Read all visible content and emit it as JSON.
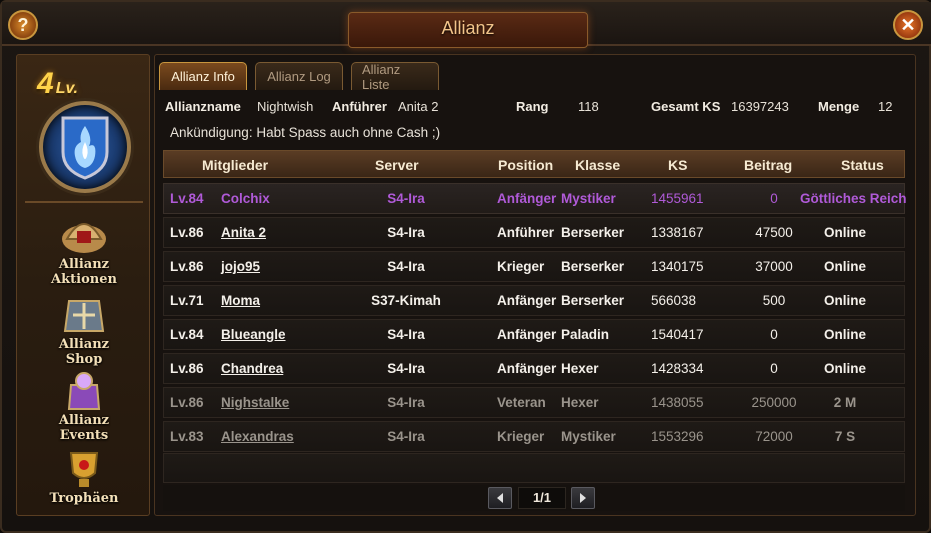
{
  "window": {
    "title": "Allianz",
    "help_label": "?",
    "close_label": "✕"
  },
  "sidebar": {
    "level_number": "4",
    "level_suffix": "Lv.",
    "items": [
      {
        "label_line1": "Allianz",
        "label_line2": "Aktionen",
        "icon": "helmet-icon"
      },
      {
        "label_line1": "Allianz",
        "label_line2": "Shop",
        "icon": "shop-icon"
      },
      {
        "label_line1": "Allianz",
        "label_line2": "Events",
        "icon": "events-icon"
      },
      {
        "label_line1": "Trophäen",
        "label_line2": "",
        "icon": "trophy-icon"
      }
    ]
  },
  "tabs": [
    {
      "label": "Allianz Info",
      "active": true
    },
    {
      "label": "Allianz Log",
      "active": false
    },
    {
      "label": "Allianz Liste",
      "active": false
    }
  ],
  "info": {
    "name_label": "Allianzname",
    "name_value": "Nightwish",
    "leader_label": "Anführer",
    "leader_value": "Anita 2",
    "rank_label": "Rang",
    "rank_value": "118",
    "total_label": "Gesamt KS",
    "total_value": "16397243",
    "count_label": "Menge",
    "count_value": "12",
    "announcement": "Ankündigung: Habt Spass auch ohne Cash ;)"
  },
  "table": {
    "headers": [
      "Mitglieder",
      "Server",
      "Position",
      "Klasse",
      "KS",
      "Beitrag",
      "Status"
    ],
    "rows": [
      {
        "level": "Lv.84",
        "name": "Colchix",
        "server": "S4-Ira",
        "position": "Anfänger",
        "klasse": "Mystiker",
        "ks": "1455961",
        "beitrag": "0",
        "status": "Göttliches Reich",
        "state": "self"
      },
      {
        "level": "Lv.86",
        "name": "Anita 2",
        "server": "S4-Ira",
        "position": "Anführer",
        "klasse": "Berserker",
        "ks": "1338167",
        "beitrag": "47500",
        "status": "Online",
        "state": "online"
      },
      {
        "level": "Lv.86",
        "name": "jojo95",
        "server": "S4-Ira",
        "position": "Krieger",
        "klasse": "Berserker",
        "ks": "1340175",
        "beitrag": "37000",
        "status": "Online",
        "state": "online"
      },
      {
        "level": "Lv.71",
        "name": "Moma",
        "server": "S37-Kimah",
        "position": "Anfänger",
        "klasse": "Berserker",
        "ks": "566038",
        "beitrag": "500",
        "status": "Online",
        "state": "online"
      },
      {
        "level": "Lv.84",
        "name": "Blueangle",
        "server": "S4-Ira",
        "position": "Anfänger",
        "klasse": "Paladin",
        "ks": "1540417",
        "beitrag": "0",
        "status": "Online",
        "state": "online"
      },
      {
        "level": "Lv.86",
        "name": "Chandrea",
        "server": "S4-Ira",
        "position": "Anfänger",
        "klasse": "Hexer",
        "ks": "1428334",
        "beitrag": "0",
        "status": "Online",
        "state": "online"
      },
      {
        "level": "Lv.86",
        "name": "Nighstalke",
        "server": "S4-Ira",
        "position": "Veteran",
        "klasse": "Hexer",
        "ks": "1438055",
        "beitrag": "250000",
        "status": "2 M",
        "state": "offline"
      },
      {
        "level": "Lv.83",
        "name": "Alexandras",
        "server": "S4-Ira",
        "position": "Krieger",
        "klasse": "Mystiker",
        "ks": "1553296",
        "beitrag": "72000",
        "status": "7 S",
        "state": "offline"
      }
    ]
  },
  "pager": {
    "value": "1/1",
    "prev_icon": "triangle-left-icon",
    "next_icon": "triangle-right-icon"
  },
  "colors": {
    "accent": "#c8963e",
    "self_row": "#b05ad8",
    "offline": "#9a948c",
    "online": "#f4f0ea"
  }
}
